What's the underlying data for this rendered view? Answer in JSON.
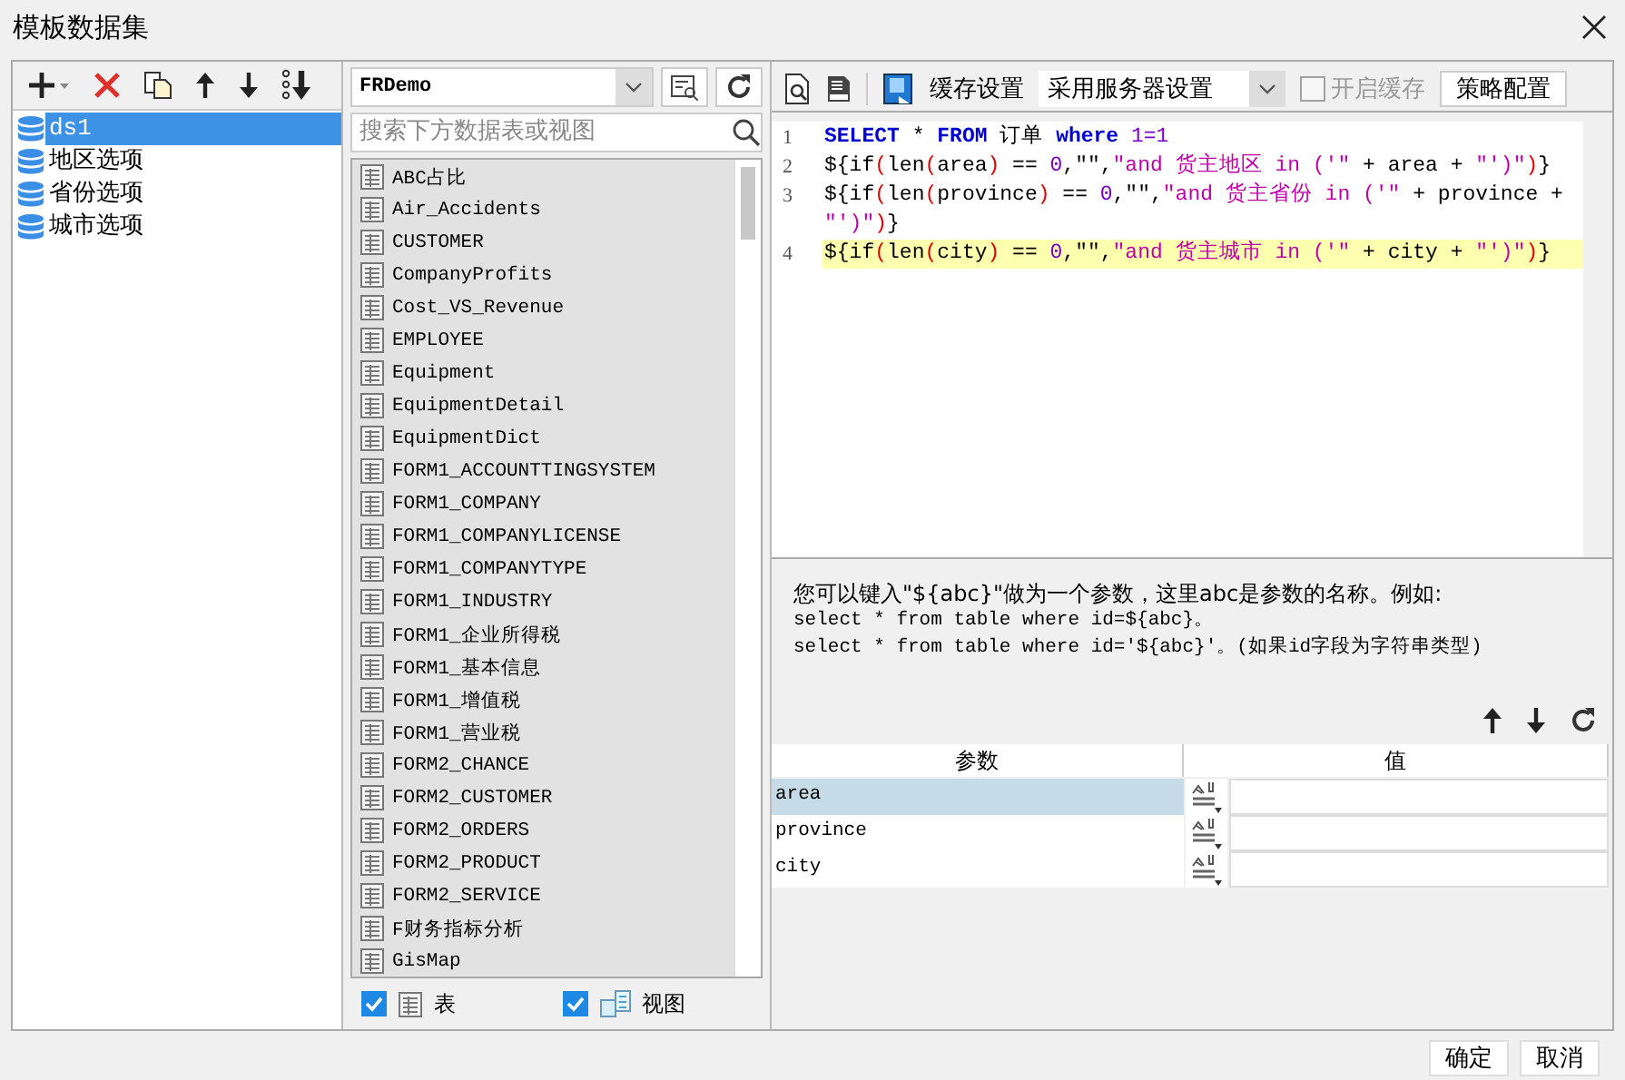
{
  "window": {
    "title": "模板数据集"
  },
  "dataset_tree": {
    "items": [
      {
        "label": "ds1",
        "selected": true
      },
      {
        "label": "地区选项",
        "selected": false
      },
      {
        "label": "省份选项",
        "selected": false
      },
      {
        "label": "城市选项",
        "selected": false
      }
    ]
  },
  "connection": {
    "value": "FRDemo"
  },
  "table_search": {
    "placeholder": "搜索下方数据表或视图"
  },
  "tables": [
    "ABC占比",
    "Air_Accidents",
    "CUSTOMER",
    "CompanyProfits",
    "Cost_VS_Revenue",
    "EMPLOYEE",
    "Equipment",
    "EquipmentDetail",
    "EquipmentDict",
    "FORM1_ACCOUNTTINGSYSTEM",
    "FORM1_COMPANY",
    "FORM1_COMPANYLICENSE",
    "FORM1_COMPANYTYPE",
    "FORM1_INDUSTRY",
    "FORM1_企业所得税",
    "FORM1_基本信息",
    "FORM1_增值税",
    "FORM1_营业税",
    "FORM2_CHANCE",
    "FORM2_CUSTOMER",
    "FORM2_ORDERS",
    "FORM2_PRODUCT",
    "FORM2_SERVICE",
    "F财务指标分析",
    "GisMap"
  ],
  "filters": [
    {
      "kind": "table",
      "label": "表",
      "checked": true
    },
    {
      "kind": "view",
      "label": "视图",
      "checked": true
    }
  ],
  "toolbar": {
    "cache_label": "缓存设置",
    "cache_mode": "采用服务器设置",
    "enable_cache": {
      "label": "开启缓存",
      "checked": false,
      "disabled": true
    },
    "strategy_button": "策略配置"
  },
  "sql": {
    "lines": [
      {
        "number": "1",
        "highlighted": false,
        "tokens": [
          {
            "kind": "kw",
            "text": "SELECT"
          },
          {
            "kind": "plain",
            "text": " * "
          },
          {
            "kind": "kw",
            "text": "FROM"
          },
          {
            "kind": "plain",
            "text": " 订单 "
          },
          {
            "kind": "kw",
            "text": "where"
          },
          {
            "kind": "num",
            "text": " 1=1"
          }
        ]
      },
      {
        "number": "2",
        "highlighted": false,
        "tokens": [
          {
            "kind": "plain",
            "text": "${if"
          },
          {
            "kind": "paren",
            "text": "("
          },
          {
            "kind": "plain",
            "text": "len"
          },
          {
            "kind": "paren",
            "text": "("
          },
          {
            "kind": "plain",
            "text": "area"
          },
          {
            "kind": "paren",
            "text": ")"
          },
          {
            "kind": "plain",
            "text": " == "
          },
          {
            "kind": "num",
            "text": "0"
          },
          {
            "kind": "plain",
            "text": ",\"\","
          },
          {
            "kind": "str",
            "text": "\"and 货主地区 in ('\""
          },
          {
            "kind": "plain",
            "text": " + area + "
          },
          {
            "kind": "str",
            "text": "\"')\""
          },
          {
            "kind": "paren",
            "text": ")"
          },
          {
            "kind": "plain",
            "text": "}"
          }
        ]
      },
      {
        "number": "3",
        "highlighted": false,
        "tokens": [
          {
            "kind": "plain",
            "text": "${if"
          },
          {
            "kind": "paren",
            "text": "("
          },
          {
            "kind": "plain",
            "text": "len"
          },
          {
            "kind": "paren",
            "text": "("
          },
          {
            "kind": "plain",
            "text": "province"
          },
          {
            "kind": "paren",
            "text": ")"
          },
          {
            "kind": "plain",
            "text": " == "
          },
          {
            "kind": "num",
            "text": "0"
          },
          {
            "kind": "plain",
            "text": ",\"\","
          },
          {
            "kind": "str",
            "text": "\"and 货主省份 in ('\""
          },
          {
            "kind": "plain",
            "text": " + province + "
          },
          {
            "kind": "str",
            "text": "\"')\""
          },
          {
            "kind": "paren",
            "text": ")"
          },
          {
            "kind": "plain",
            "text": "}"
          }
        ]
      },
      {
        "number": "4",
        "highlighted": true,
        "tokens": [
          {
            "kind": "plain",
            "text": "${if"
          },
          {
            "kind": "paren",
            "text": "("
          },
          {
            "kind": "plain",
            "text": "len"
          },
          {
            "kind": "paren",
            "text": "("
          },
          {
            "kind": "plain",
            "text": "city"
          },
          {
            "kind": "paren",
            "text": ")"
          },
          {
            "kind": "plain",
            "text": " == "
          },
          {
            "kind": "num",
            "text": "0"
          },
          {
            "kind": "plain",
            "text": ",\"\","
          },
          {
            "kind": "str",
            "text": "\"and 货主城市 in ('\""
          },
          {
            "kind": "plain",
            "text": " + city + "
          },
          {
            "kind": "str",
            "text": "\"')\""
          },
          {
            "kind": "paren",
            "text": ")"
          },
          {
            "kind": "plain",
            "text": "}"
          }
        ]
      }
    ]
  },
  "hint": {
    "lines": [
      "您可以键入\"${abc}\"做为一个参数，这里abc是参数的名称。例如:",
      "select * from table where id=${abc}。",
      "select * from table where id='${abc}'。(如果id字段为字符串类型)"
    ]
  },
  "params": {
    "columns": [
      "参数",
      "值"
    ],
    "rows": [
      {
        "name": "area",
        "selected": true
      },
      {
        "name": "province",
        "selected": false
      },
      {
        "name": "city",
        "selected": false
      }
    ]
  },
  "buttons": [
    "确定",
    "取消"
  ]
}
